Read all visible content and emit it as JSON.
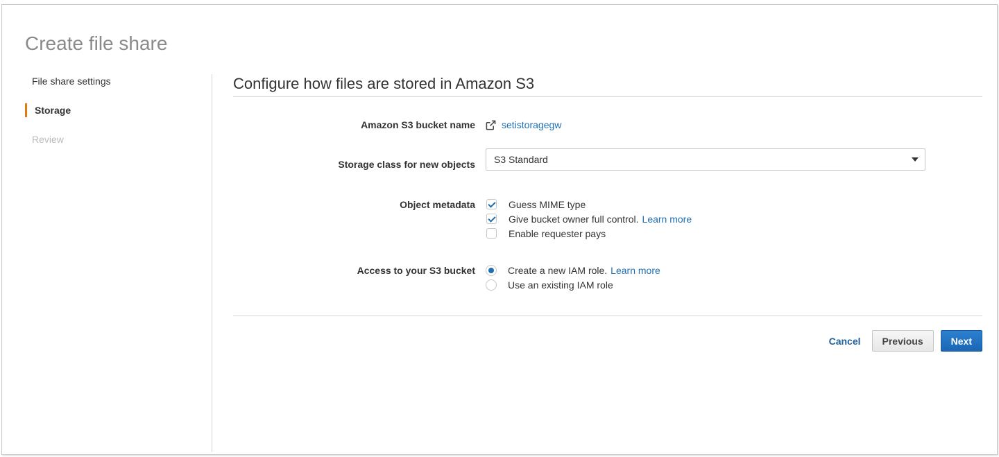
{
  "page_title": "Create file share",
  "sidenav": {
    "items": [
      {
        "label": "File share settings",
        "state": "normal"
      },
      {
        "label": "Storage",
        "state": "active"
      },
      {
        "label": "Review",
        "state": "disabled"
      }
    ]
  },
  "section": {
    "title": "Configure how files are stored in Amazon S3"
  },
  "bucket": {
    "label": "Amazon S3 bucket name",
    "value": "setistoragegw",
    "icon": "external-link-icon"
  },
  "storage_class": {
    "label": "Storage class for new objects",
    "selected": "S3 Standard"
  },
  "object_metadata": {
    "label": "Object metadata",
    "options": [
      {
        "label": "Guess MIME type",
        "checked": true,
        "link": ""
      },
      {
        "label": "Give bucket owner full control.",
        "checked": true,
        "link": "Learn more"
      },
      {
        "label": "Enable requester pays",
        "checked": false,
        "link": ""
      }
    ]
  },
  "access": {
    "label": "Access to your S3 bucket",
    "options": [
      {
        "label": "Create a new IAM role.",
        "selected": true,
        "link": "Learn more"
      },
      {
        "label": "Use an existing IAM role",
        "selected": false,
        "link": ""
      }
    ]
  },
  "buttons": {
    "cancel": "Cancel",
    "previous": "Previous",
    "next": "Next"
  },
  "colors": {
    "accent": "#e07b14",
    "link": "#1f6fb2",
    "primary": "#1b66b5"
  }
}
